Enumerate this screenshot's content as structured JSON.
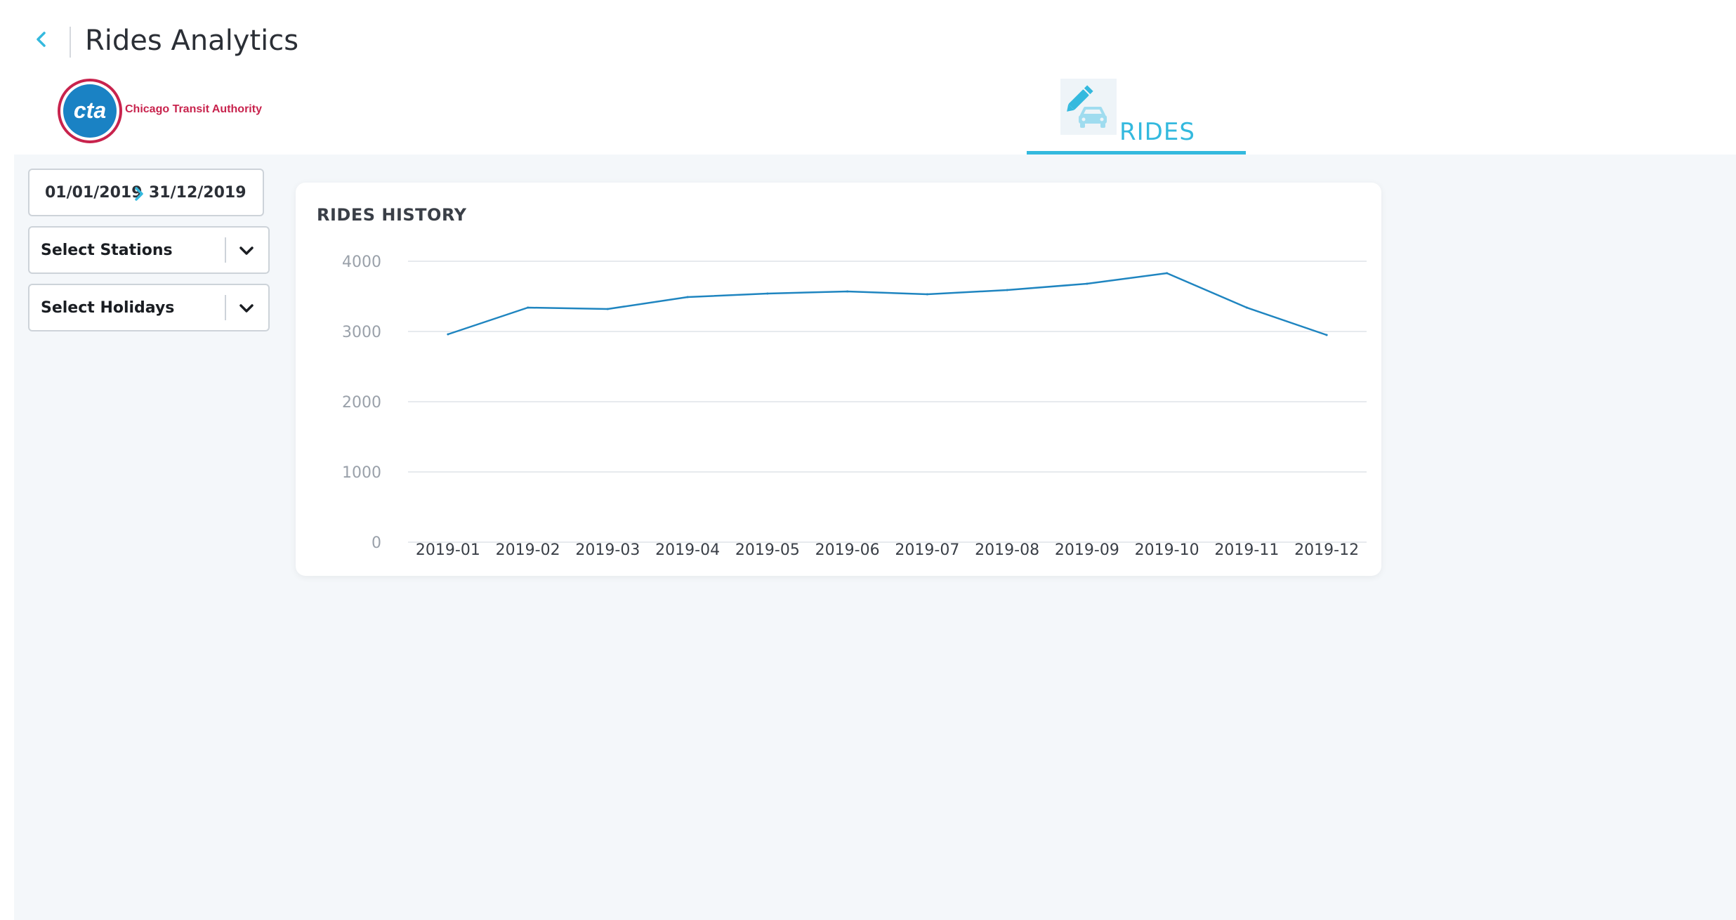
{
  "header": {
    "title": "Rides Analytics",
    "back_icon": "chevron-left-icon"
  },
  "logo": {
    "mark_text": "cta",
    "name": "Chicago Transit Authority"
  },
  "tabs": [
    {
      "label": "RIDES",
      "icon": "pencil-car-icon",
      "active": true
    }
  ],
  "filters": {
    "date_start": "01/01/2019",
    "date_end": "31/12/2019",
    "stations_label": "Select Stations",
    "holidays_label": "Select Holidays"
  },
  "colors": {
    "accent": "#34b9de",
    "line": "#1f85c0",
    "logo_red": "#c8234d",
    "logo_blue": "#1a82c4"
  },
  "chart_data": {
    "type": "line",
    "title": "RIDES HISTORY",
    "xlabel": "",
    "ylabel": "",
    "categories": [
      "2019-01",
      "2019-02",
      "2019-03",
      "2019-04",
      "2019-05",
      "2019-06",
      "2019-07",
      "2019-08",
      "2019-09",
      "2019-10",
      "2019-11",
      "2019-12"
    ],
    "series": [
      {
        "values": [
          2960,
          3340,
          3320,
          3490,
          3540,
          3570,
          3530,
          3590,
          3680,
          3830,
          3340,
          2950
        ]
      }
    ],
    "ylim": [
      0,
      4000
    ],
    "yticks": [
      "4000",
      "3000",
      "2000",
      "1000",
      "0"
    ],
    "grid": true,
    "legend": "none"
  }
}
